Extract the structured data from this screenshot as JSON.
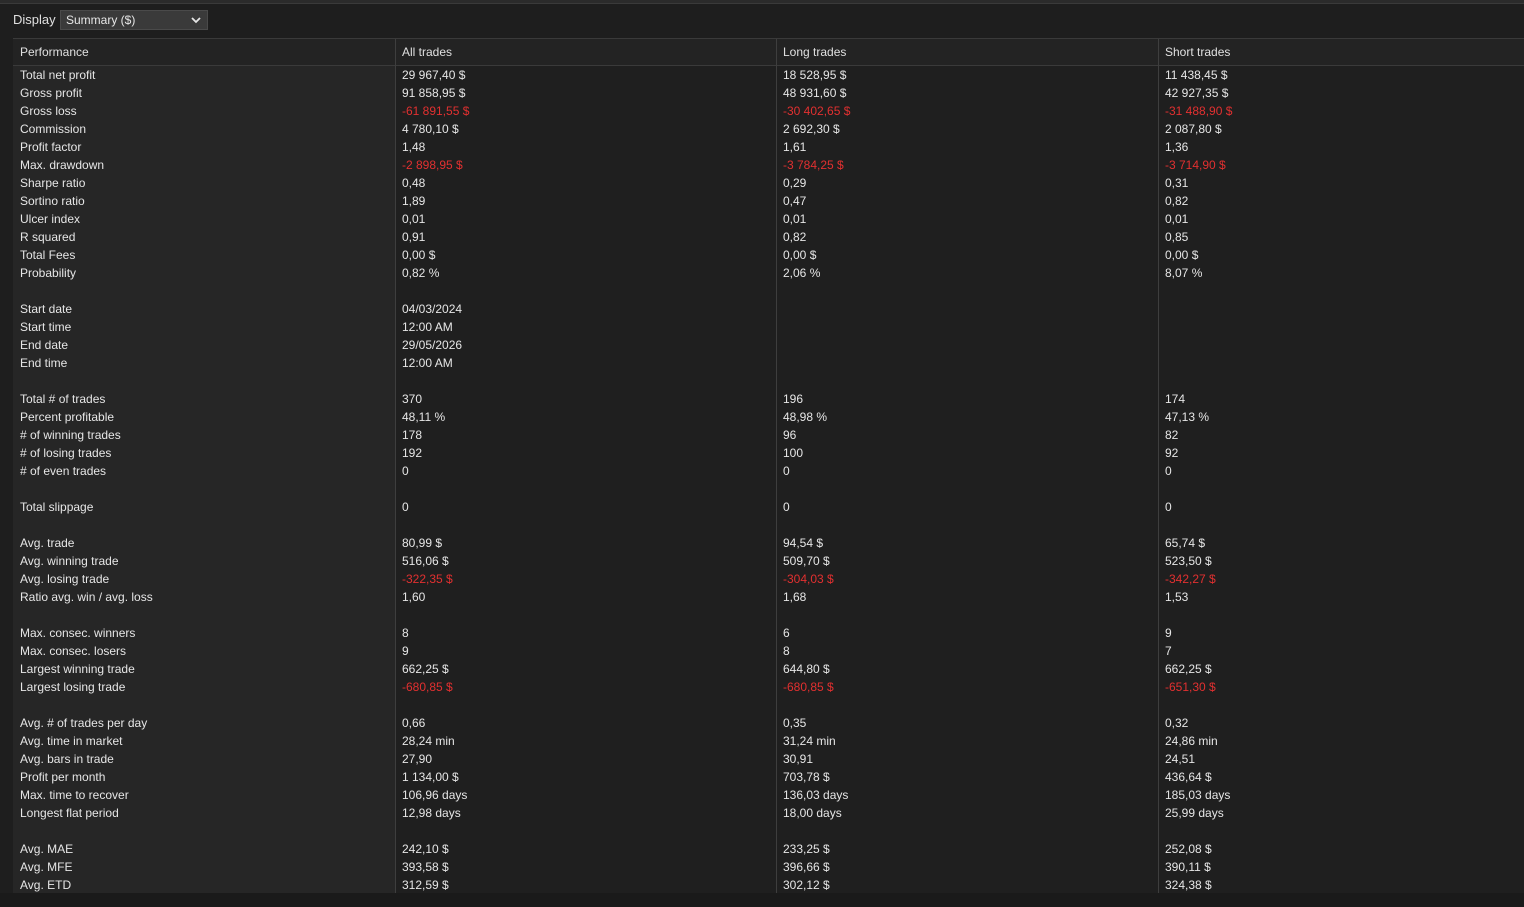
{
  "toolbar": {
    "display_label": "Display",
    "display_value": "Summary ($)"
  },
  "headers": [
    "Performance",
    "All trades",
    "Long trades",
    "Short trades"
  ],
  "rows": [
    {
      "label": "Total net profit",
      "all": "29 967,40 $",
      "long": "18 528,95 $",
      "short": "11 438,45 $",
      "neg": false
    },
    {
      "label": "Gross profit",
      "all": "91 858,95 $",
      "long": "48 931,60 $",
      "short": "42 927,35 $",
      "neg": false
    },
    {
      "label": "Gross loss",
      "all": "-61 891,55 $",
      "long": "-30 402,65 $",
      "short": "-31 488,90 $",
      "neg": true
    },
    {
      "label": "Commission",
      "all": "4 780,10 $",
      "long": "2 692,30 $",
      "short": "2 087,80 $",
      "neg": false
    },
    {
      "label": "Profit factor",
      "all": "1,48",
      "long": "1,61",
      "short": "1,36",
      "neg": false
    },
    {
      "label": "Max. drawdown",
      "all": "-2 898,95 $",
      "long": "-3 784,25 $",
      "short": "-3 714,90 $",
      "neg": true
    },
    {
      "label": "Sharpe ratio",
      "all": "0,48",
      "long": "0,29",
      "short": "0,31",
      "neg": false
    },
    {
      "label": "Sortino ratio",
      "all": "1,89",
      "long": "0,47",
      "short": "0,82",
      "neg": false
    },
    {
      "label": "Ulcer index",
      "all": "0,01",
      "long": "0,01",
      "short": "0,01",
      "neg": false
    },
    {
      "label": "R squared",
      "all": "0,91",
      "long": "0,82",
      "short": "0,85",
      "neg": false
    },
    {
      "label": "Total Fees",
      "all": "0,00 $",
      "long": "0,00 $",
      "short": "0,00 $",
      "neg": false
    },
    {
      "label": "Probability",
      "all": "0,82 %",
      "long": "2,06 %",
      "short": "8,07 %",
      "neg": false
    },
    {
      "label": "",
      "all": "",
      "long": "",
      "short": "",
      "neg": false
    },
    {
      "label": "Start date",
      "all": "04/03/2024",
      "long": "",
      "short": "",
      "neg": false
    },
    {
      "label": "Start time",
      "all": "12:00 AM",
      "long": "",
      "short": "",
      "neg": false
    },
    {
      "label": "End date",
      "all": "29/05/2026",
      "long": "",
      "short": "",
      "neg": false
    },
    {
      "label": "End time",
      "all": "12:00 AM",
      "long": "",
      "short": "",
      "neg": false
    },
    {
      "label": "",
      "all": "",
      "long": "",
      "short": "",
      "neg": false
    },
    {
      "label": "Total # of trades",
      "all": "370",
      "long": "196",
      "short": "174",
      "neg": false
    },
    {
      "label": "Percent profitable",
      "all": "48,11 %",
      "long": "48,98 %",
      "short": "47,13 %",
      "neg": false
    },
    {
      "label": "# of winning trades",
      "all": "178",
      "long": "96",
      "short": "82",
      "neg": false
    },
    {
      "label": "# of losing trades",
      "all": "192",
      "long": "100",
      "short": "92",
      "neg": false
    },
    {
      "label": "# of even trades",
      "all": "0",
      "long": "0",
      "short": "0",
      "neg": false
    },
    {
      "label": "",
      "all": "",
      "long": "",
      "short": "",
      "neg": false
    },
    {
      "label": "Total slippage",
      "all": "0",
      "long": "0",
      "short": "0",
      "neg": false
    },
    {
      "label": "",
      "all": "",
      "long": "",
      "short": "",
      "neg": false
    },
    {
      "label": "Avg. trade",
      "all": "80,99 $",
      "long": "94,54 $",
      "short": "65,74 $",
      "neg": false
    },
    {
      "label": "Avg. winning trade",
      "all": "516,06 $",
      "long": "509,70 $",
      "short": "523,50 $",
      "neg": false
    },
    {
      "label": "Avg. losing trade",
      "all": "-322,35 $",
      "long": "-304,03 $",
      "short": "-342,27 $",
      "neg": true
    },
    {
      "label": "Ratio avg. win / avg. loss",
      "all": "1,60",
      "long": "1,68",
      "short": "1,53",
      "neg": false
    },
    {
      "label": "",
      "all": "",
      "long": "",
      "short": "",
      "neg": false
    },
    {
      "label": "Max. consec. winners",
      "all": "8",
      "long": "6",
      "short": "9",
      "neg": false
    },
    {
      "label": "Max. consec. losers",
      "all": "9",
      "long": "8",
      "short": "7",
      "neg": false
    },
    {
      "label": "Largest winning trade",
      "all": "662,25 $",
      "long": "644,80 $",
      "short": "662,25 $",
      "neg": false
    },
    {
      "label": "Largest losing trade",
      "all": "-680,85 $",
      "long": "-680,85 $",
      "short": "-651,30 $",
      "neg": true
    },
    {
      "label": "",
      "all": "",
      "long": "",
      "short": "",
      "neg": false
    },
    {
      "label": "Avg. # of trades per day",
      "all": "0,66",
      "long": "0,35",
      "short": "0,32",
      "neg": false
    },
    {
      "label": "Avg. time in market",
      "all": "28,24 min",
      "long": "31,24 min",
      "short": "24,86 min",
      "neg": false
    },
    {
      "label": "Avg. bars in trade",
      "all": "27,90",
      "long": "30,91",
      "short": "24,51",
      "neg": false
    },
    {
      "label": "Profit per month",
      "all": "1 134,00 $",
      "long": "703,78 $",
      "short": "436,64 $",
      "neg": false
    },
    {
      "label": "Max. time to recover",
      "all": "106,96 days",
      "long": "136,03 days",
      "short": "185,03 days",
      "neg": false
    },
    {
      "label": "Longest flat period",
      "all": "12,98 days",
      "long": "18,00 days",
      "short": "25,99 days",
      "neg": false
    },
    {
      "label": "",
      "all": "",
      "long": "",
      "short": "",
      "neg": false
    },
    {
      "label": "Avg. MAE",
      "all": "242,10 $",
      "long": "233,25 $",
      "short": "252,08 $",
      "neg": false
    },
    {
      "label": "Avg. MFE",
      "all": "393,58 $",
      "long": "396,66 $",
      "short": "390,11 $",
      "neg": false
    },
    {
      "label": "Avg. ETD",
      "all": "312,59 $",
      "long": "302,12 $",
      "short": "324,38 $",
      "neg": false
    }
  ],
  "colors": {
    "negative": "#e23030",
    "background": "#1e1e1e",
    "text": "#e6e6e6"
  }
}
